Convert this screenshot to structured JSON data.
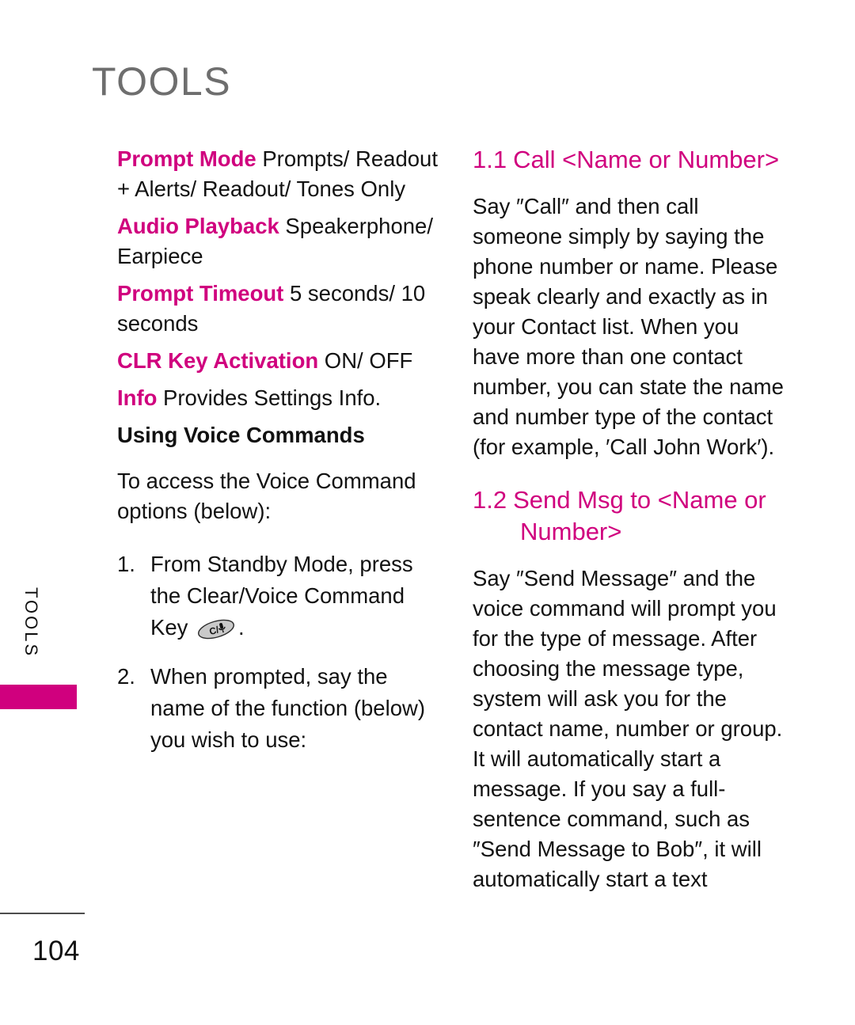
{
  "page": {
    "chapter_title": "TOOLS",
    "side_tab_label": "TOOLS",
    "page_number": "104",
    "accent_color": "#d0007e",
    "title_color": "#6e6e6e"
  },
  "left_column": {
    "settings": [
      {
        "term": "Prompt Mode",
        "value": " Prompts/ Readout + Alerts/ Readout/ Tones Only"
      },
      {
        "term": "Audio Playback",
        "value": " Speakerphone/ Earpiece"
      },
      {
        "term": "Prompt Timeout",
        "value": "  5 seconds/ 10 seconds"
      },
      {
        "term": "CLR Key Activation",
        "value": "  ON/ OFF"
      },
      {
        "term": "Info",
        "value": "  Provides Settings Info."
      }
    ],
    "subheading": "Using Voice Commands",
    "intro": "To access the Voice Command options (below):",
    "steps": [
      {
        "number": "1.",
        "text_before": "From Standby Mode, press the Clear/Voice Command Key ",
        "icon": "clear-voice-command-key-icon",
        "icon_label": "C/",
        "text_after": "."
      },
      {
        "number": "2.",
        "text_before": "When prompted, say the name of the function (below) you wish to use:",
        "icon": "",
        "icon_label": "",
        "text_after": ""
      }
    ]
  },
  "right_column": {
    "sections": [
      {
        "number": "1.1",
        "title": "Call <Name or Number>",
        "title_continuation": "",
        "body": "Say ″Call″ and then call someone simply by saying the phone number or name. Please speak clearly and exactly as in your Contact list. When you have more than one contact number, you can state the name and number type of the contact (for example, ′Call John Work′)."
      },
      {
        "number": "1.2",
        "title": "Send Msg to <Name or",
        "title_continuation": "Number>",
        "body": "Say ″Send Message″ and the voice command will prompt you for the type of message. After choosing the message type, system will ask you for the contact name, number or group. It will automatically start a message. If you say a full-sentence command, such as ″Send Message to Bob″, it will automatically start a text"
      }
    ]
  }
}
